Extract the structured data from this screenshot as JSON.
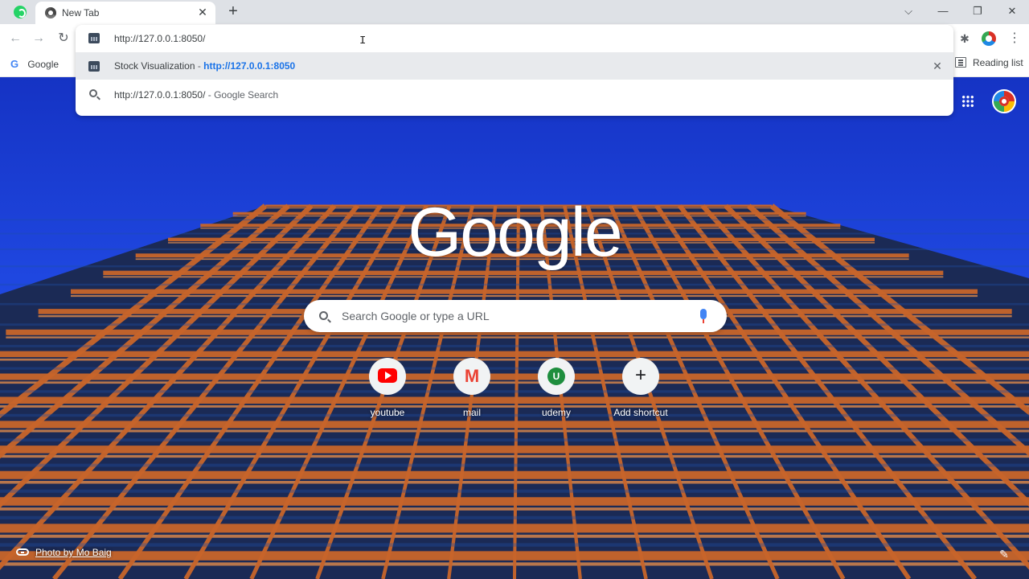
{
  "browser": {
    "tab": {
      "title": "New Tab",
      "close": "✕"
    },
    "new_tab": "+",
    "window_controls": {
      "list": "⌵",
      "minimize": "—",
      "restore": "❐",
      "close": "✕"
    },
    "nav": {
      "back": "←",
      "forward": "→",
      "reload": "↻"
    },
    "omnibox": {
      "value": "http://127.0.0.1:8050/",
      "suggestions": [
        {
          "title": "Stock Visualization",
          "separator": " - ",
          "url": "http://127.0.0.1:8050",
          "icon": "site-favicon",
          "remove": "✕"
        },
        {
          "query": "http://127.0.0.1:8050/",
          "suffix": " - Google Search",
          "icon": "search-icon"
        }
      ]
    },
    "extensions": {
      "puzzle": "✱",
      "menu": "⋮"
    },
    "bookmarks": [
      {
        "label": "Google"
      }
    ],
    "reading_list": "Reading list"
  },
  "ntp": {
    "logo": "Google",
    "search_placeholder": "Search Google or type a URL",
    "shortcuts": [
      {
        "label": "youtube",
        "icon": "youtube-icon"
      },
      {
        "label": "mail",
        "icon": "gmail-icon",
        "glyph": "M"
      },
      {
        "label": "udemy",
        "icon": "udemy-icon",
        "glyph": "U"
      },
      {
        "label": "Add shortcut",
        "icon": "add-icon",
        "glyph": "+"
      }
    ],
    "photo_credit": "Photo by Mo Baig",
    "customize": "✎"
  },
  "colors": {
    "sky": "#1f47e0",
    "building": "#c8652a",
    "accent": "#1a73e8"
  }
}
